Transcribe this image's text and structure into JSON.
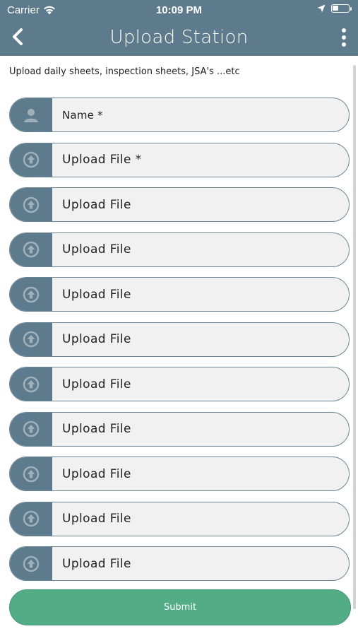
{
  "status": {
    "carrier": "Carrier",
    "time": "10:09 PM",
    "battery_level": 0.35
  },
  "header": {
    "title": "Upload Station"
  },
  "subtitle": "Upload daily sheets, inspection sheets, JSA's ...etc",
  "fields": [
    {
      "label": "Name *",
      "icon": "person-icon"
    },
    {
      "label": "Upload File *",
      "icon": "upload-icon"
    },
    {
      "label": "Upload File",
      "icon": "upload-icon"
    },
    {
      "label": "Upload File",
      "icon": "upload-icon"
    },
    {
      "label": "Upload File",
      "icon": "upload-icon"
    },
    {
      "label": "Upload File",
      "icon": "upload-icon"
    },
    {
      "label": "Upload File",
      "icon": "upload-icon"
    },
    {
      "label": "Upload File",
      "icon": "upload-icon"
    },
    {
      "label": "Upload File",
      "icon": "upload-icon"
    },
    {
      "label": "Upload File",
      "icon": "upload-icon"
    },
    {
      "label": "Upload File",
      "icon": "upload-icon"
    }
  ],
  "submit_label": "Submit",
  "colors": {
    "header": "#5e7b8d",
    "submit": "#52ad87",
    "field_bg": "#f1f1f1"
  }
}
